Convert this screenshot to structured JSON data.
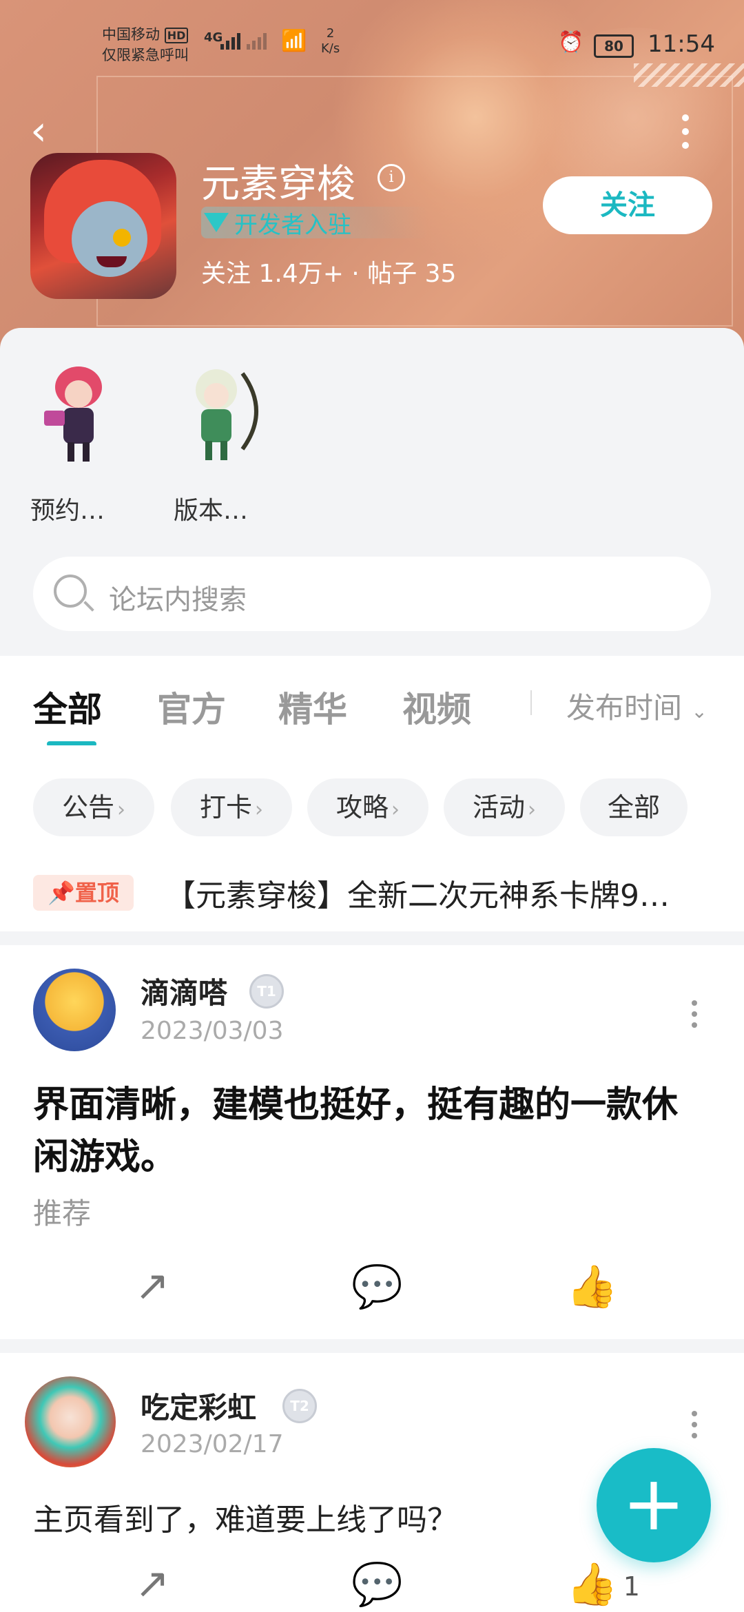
{
  "status_bar": {
    "carrier": "中国移动",
    "carrier_badge": "HD",
    "emergency": "仅限紧急呼叫",
    "network": "4G",
    "speed_value": "2",
    "speed_unit": "K/s",
    "battery": "80",
    "time": "11:54"
  },
  "header": {
    "title": "元素穿梭",
    "developer_badge": "开发者入驻",
    "stats": "关注 1.4万+ · 帖子 35",
    "follow_label": "关注"
  },
  "quick_links": [
    {
      "label": "预约…"
    },
    {
      "label": "版本…"
    }
  ],
  "search": {
    "placeholder": "论坛内搜索"
  },
  "tabs": [
    {
      "label": "全部",
      "active": true
    },
    {
      "label": "官方"
    },
    {
      "label": "精华"
    },
    {
      "label": "视频"
    }
  ],
  "sort": {
    "label": "发布时间"
  },
  "chips": [
    {
      "label": "公告"
    },
    {
      "label": "打卡"
    },
    {
      "label": "攻略"
    },
    {
      "label": "活动"
    },
    {
      "label": "全部"
    }
  ],
  "pinned": {
    "badge": "置顶",
    "text": "【元素穿梭】全新二次元神系卡牌9…"
  },
  "posts": [
    {
      "author": "滴滴嗒",
      "level": "T1",
      "date": "2023/03/03",
      "title": "界面清晰，建模也挺好，挺有趣的一款休闲游戏。",
      "tag": "推荐",
      "likes": ""
    },
    {
      "author": "吃定彩虹",
      "level": "T2",
      "date": "2023/02/17",
      "body": "主页看到了，难道要上线了吗？",
      "likes": "1"
    }
  ],
  "fab": {
    "icon": "plus-icon"
  },
  "colors": {
    "accent": "#1bb8c1",
    "header_bg": "#d99478",
    "pin_red": "#f0624a"
  }
}
